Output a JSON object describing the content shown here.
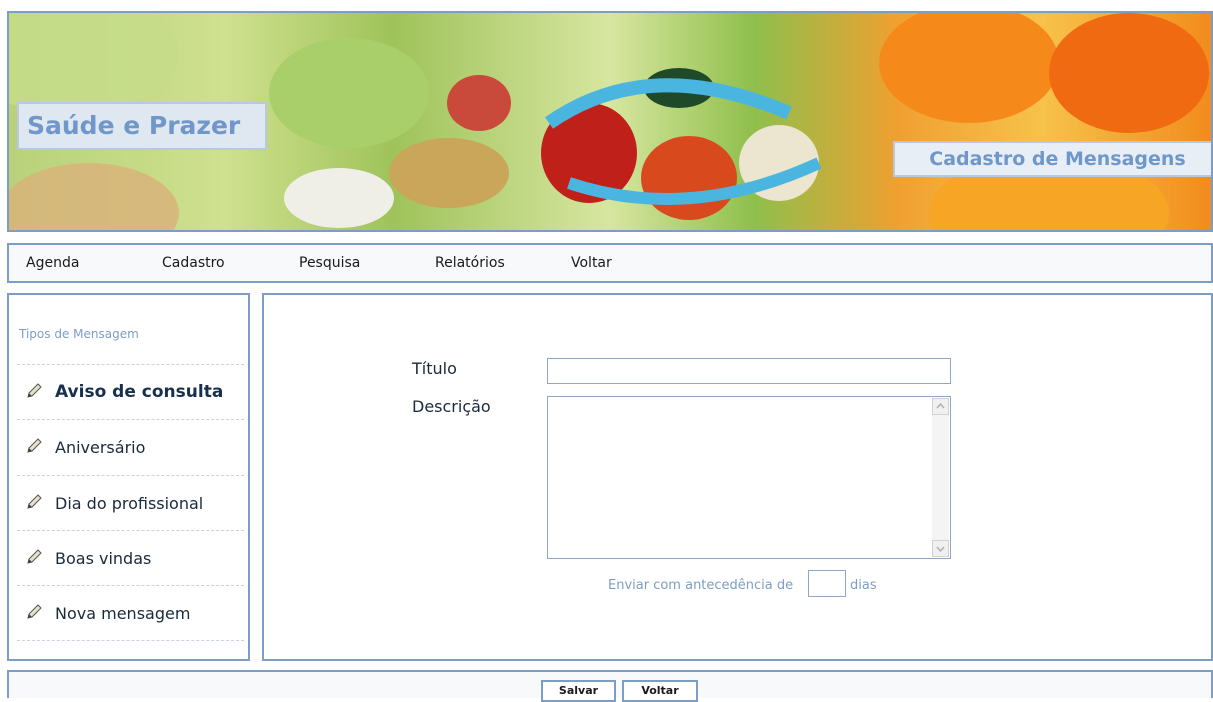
{
  "header": {
    "brand": "Saúde e Prazer",
    "page_title": "Cadastro de Mensagens"
  },
  "nav": {
    "items": [
      "Agenda",
      "Cadastro",
      "Pesquisa",
      "Relatórios",
      "Voltar"
    ]
  },
  "sidebar": {
    "title": "Tipos de Mensagem",
    "items": [
      {
        "label": "Aviso de consulta",
        "active": true,
        "icon": "pencil-icon"
      },
      {
        "label": "Aniversário",
        "active": false,
        "icon": "pencil-icon"
      },
      {
        "label": "Dia do profissional",
        "active": false,
        "icon": "pencil-icon"
      },
      {
        "label": "Boas vindas",
        "active": false,
        "icon": "pencil-icon"
      },
      {
        "label": "Nova mensagem",
        "active": false,
        "icon": "pencil-icon"
      }
    ]
  },
  "form": {
    "titulo_label": "Título",
    "titulo_value": "",
    "descricao_label": "Descrição",
    "descricao_value": "",
    "antecedencia_prefix": "Enviar com antecedência de",
    "antecedencia_value": "",
    "antecedencia_suffix": "dias"
  },
  "footer": {
    "save_label": "Salvar",
    "back_label": "Voltar"
  },
  "colors": {
    "border": "#7d9ec4",
    "accent_text": "#6f97c9"
  }
}
